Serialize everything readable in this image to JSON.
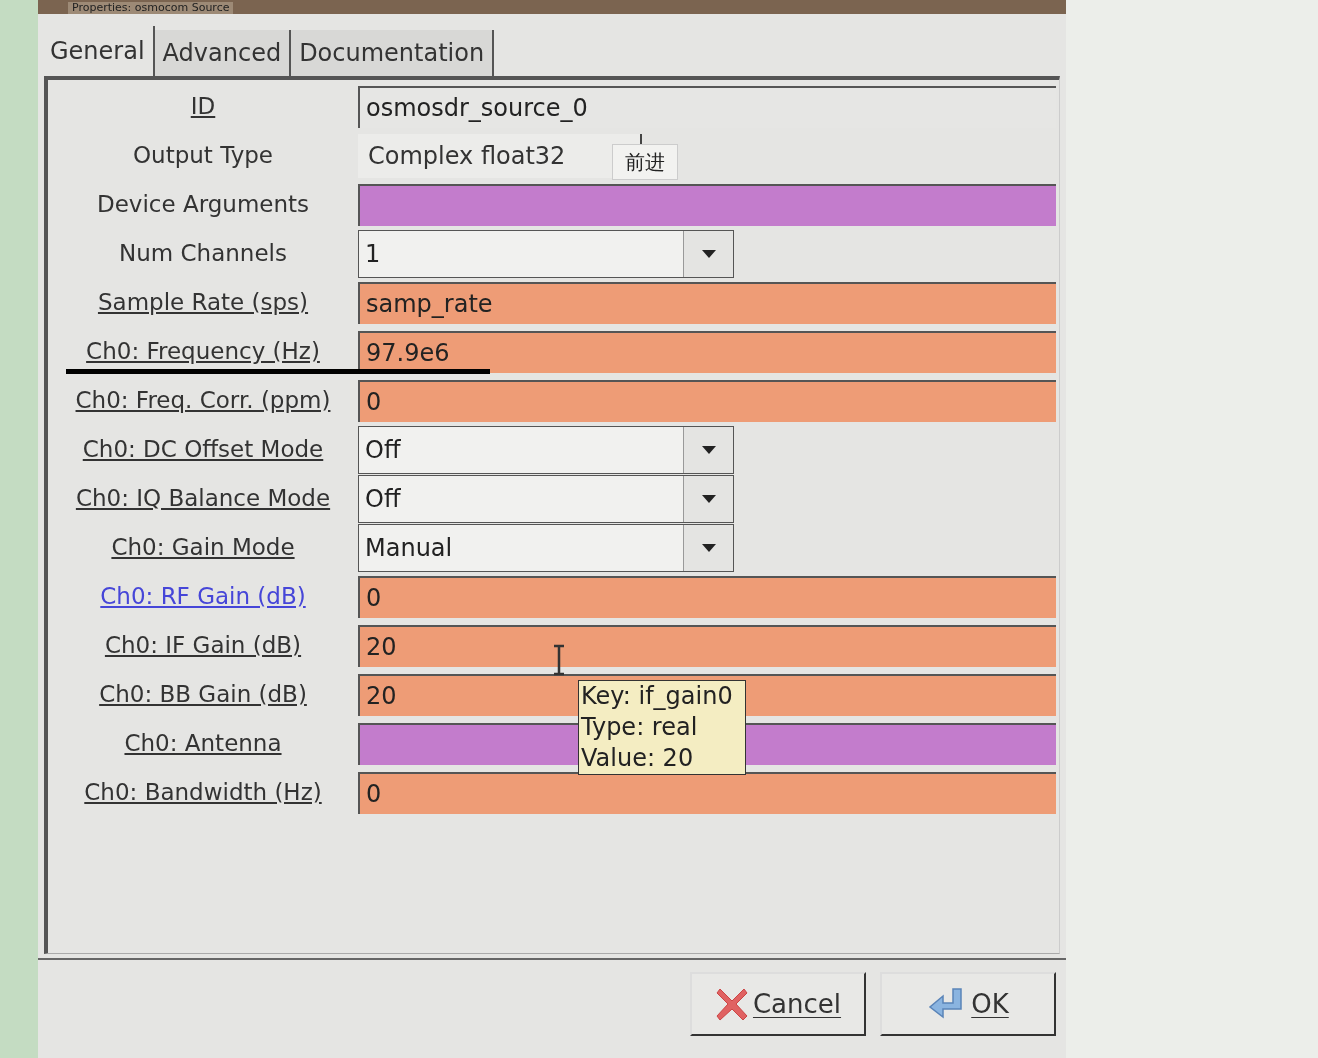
{
  "window": {
    "title": "Properties: osmocom Source"
  },
  "tabs": [
    {
      "label": "General",
      "selected": true
    },
    {
      "label": "Advanced",
      "selected": false
    },
    {
      "label": "Documentation",
      "selected": false
    }
  ],
  "rows": [
    {
      "label": "ID",
      "underlined": true,
      "hovered": false,
      "kind": "entry",
      "value": "osmosdr_source_0",
      "color": "#e6e6e4"
    },
    {
      "label": "Output Type",
      "underlined": false,
      "hovered": false,
      "kind": "combo",
      "value": "Complex float32"
    },
    {
      "label": "Device Arguments",
      "underlined": false,
      "hovered": false,
      "kind": "entry",
      "value": "",
      "color": "#c37ccc"
    },
    {
      "label": "Num Channels",
      "underlined": false,
      "hovered": false,
      "kind": "dropdown",
      "value": "1"
    },
    {
      "label": "Sample Rate (sps)",
      "underlined": true,
      "hovered": false,
      "kind": "entry",
      "value": "samp_rate",
      "color": "#ee9c76"
    },
    {
      "label": "Ch0: Frequency (Hz)",
      "underlined": true,
      "hovered": false,
      "kind": "entry",
      "value": "97.9e6",
      "color": "#ee9c76"
    },
    {
      "label": "Ch0: Freq. Corr. (ppm)",
      "underlined": true,
      "hovered": false,
      "kind": "entry",
      "value": "0",
      "color": "#ee9c76"
    },
    {
      "label": "Ch0: DC Offset Mode",
      "underlined": true,
      "hovered": false,
      "kind": "dropdown",
      "value": "Off"
    },
    {
      "label": "Ch0: IQ Balance Mode",
      "underlined": true,
      "hovered": false,
      "kind": "dropdown",
      "value": "Off"
    },
    {
      "label": "Ch0: Gain Mode",
      "underlined": true,
      "hovered": false,
      "kind": "dropdown",
      "value": "Manual"
    },
    {
      "label": "Ch0: RF Gain (dB)",
      "underlined": true,
      "hovered": true,
      "kind": "entry",
      "value": "0",
      "color": "#ee9c76"
    },
    {
      "label": "Ch0: IF Gain (dB)",
      "underlined": true,
      "hovered": false,
      "kind": "entry",
      "value": "20",
      "color": "#ee9c76"
    },
    {
      "label": "Ch0: BB Gain (dB)",
      "underlined": true,
      "hovered": false,
      "kind": "entry",
      "value": "20",
      "color": "#ee9c76"
    },
    {
      "label": "Ch0: Antenna",
      "underlined": true,
      "hovered": false,
      "kind": "entry",
      "value": "",
      "color": "#c37ccc"
    },
    {
      "label": "Ch0: Bandwidth (Hz)",
      "underlined": true,
      "hovered": false,
      "kind": "entry",
      "value": "0",
      "color": "#ee9c76"
    }
  ],
  "tooltips": [
    {
      "text": "前进"
    },
    {
      "lines": [
        "Key: if_gain0",
        "Type: real",
        "Value: 20"
      ]
    }
  ],
  "buttons": [
    {
      "label": "Cancel",
      "kind": "cancel"
    },
    {
      "label": "OK",
      "kind": "ok"
    }
  ]
}
